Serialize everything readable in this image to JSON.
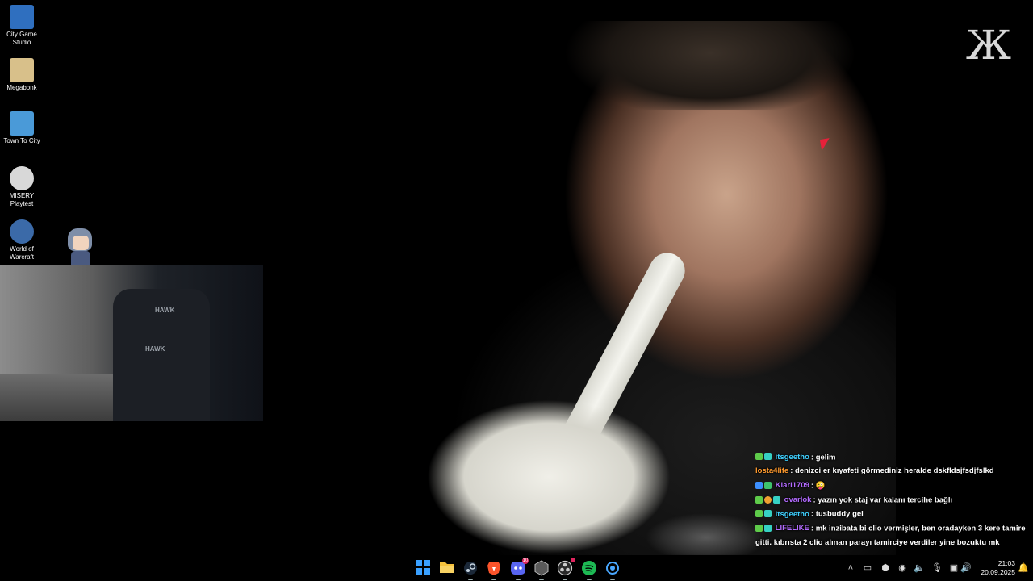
{
  "desktop_icons": [
    {
      "label": "City Game Studio",
      "icon": "city-game-studio-icon",
      "color": "#2f6fbf"
    },
    {
      "label": "Megabonk",
      "icon": "megabonk-icon",
      "color": "#d8c08a"
    },
    {
      "label": "Town To City",
      "icon": "town-to-city-icon",
      "color": "#4a9ad8"
    },
    {
      "label": "MISERY Playtest",
      "icon": "misery-playtest-icon",
      "color": "#d8d8d8"
    },
    {
      "label": "World of Warcraft",
      "icon": "world-of-warcraft-icon",
      "color": "#3b6aa8"
    }
  ],
  "webcam": {
    "brand_text": "HAWK"
  },
  "logo": {
    "text": "Ж"
  },
  "chat": {
    "messages": [
      {
        "user": "itsgeetho",
        "user_color": "#3fd0ff",
        "text": "gelim",
        "badges": [
          "#5ecb4a",
          "#36d1c4"
        ]
      },
      {
        "user": "losta4life",
        "user_color": "#ff9a2e",
        "text": "denizci er kıyafeti görmediniz heralde dskfldsjfsdjfslkd",
        "badges": []
      },
      {
        "user": "Kiari1709",
        "user_color": "#b36bff",
        "text": "😜",
        "badges": [
          "#3c8fff",
          "#3ec46d"
        ]
      },
      {
        "user": "ovarlok",
        "user_color": "#b36bff",
        "text": "yazın yok staj var kalanı tercihe bağlı",
        "badges": [
          "#5ecb4a",
          "#f0a030",
          "#36d1c4"
        ]
      },
      {
        "user": "itsgeetho",
        "user_color": "#3fd0ff",
        "text": "tusbuddy gel",
        "badges": [
          "#5ecb4a",
          "#36d1c4"
        ]
      },
      {
        "user": "LIFELIKE",
        "user_color": "#b36bff",
        "text": "mk inzibata bi clio vermişler, ben oradayken 3 kere tamire gitti. kıbrısta 2 clio alınan parayı tamirciye verdiler yine bozuktu mk",
        "badges": [
          "#5ecb4a",
          "#36d1c4"
        ]
      }
    ]
  },
  "taskbar": {
    "apps": [
      {
        "name": "start-button",
        "icon": "windows-logo-icon",
        "color": "#3aa0ff"
      },
      {
        "name": "file-explorer",
        "icon": "folder-icon",
        "color": "#f5c13c"
      },
      {
        "name": "steam",
        "icon": "steam-icon",
        "color": "#c7d5e0"
      },
      {
        "name": "brave",
        "icon": "brave-lion-icon",
        "color": "#fb542b"
      },
      {
        "name": "discord",
        "icon": "discord-icon",
        "color": "#5865f2",
        "badge": "10"
      },
      {
        "name": "app-cube",
        "icon": "cube-icon",
        "color": "#9a9a9a"
      },
      {
        "name": "obs",
        "icon": "obs-icon",
        "color": "#cccccc",
        "badge": ""
      },
      {
        "name": "spotify",
        "icon": "spotify-icon",
        "color": "#1db954"
      },
      {
        "name": "battle-net",
        "icon": "battle-net-icon",
        "color": "#4aa8ff"
      }
    ],
    "tray_icons": [
      "chevron-up-icon",
      "battery-icon",
      "tray-app-icon",
      "steam-tray-icon",
      "volume-icon",
      "microphone-icon",
      "speaker-icon",
      "network-icon",
      "speaker-icon-2"
    ],
    "time": "21:03",
    "date": "20.09.2025"
  }
}
